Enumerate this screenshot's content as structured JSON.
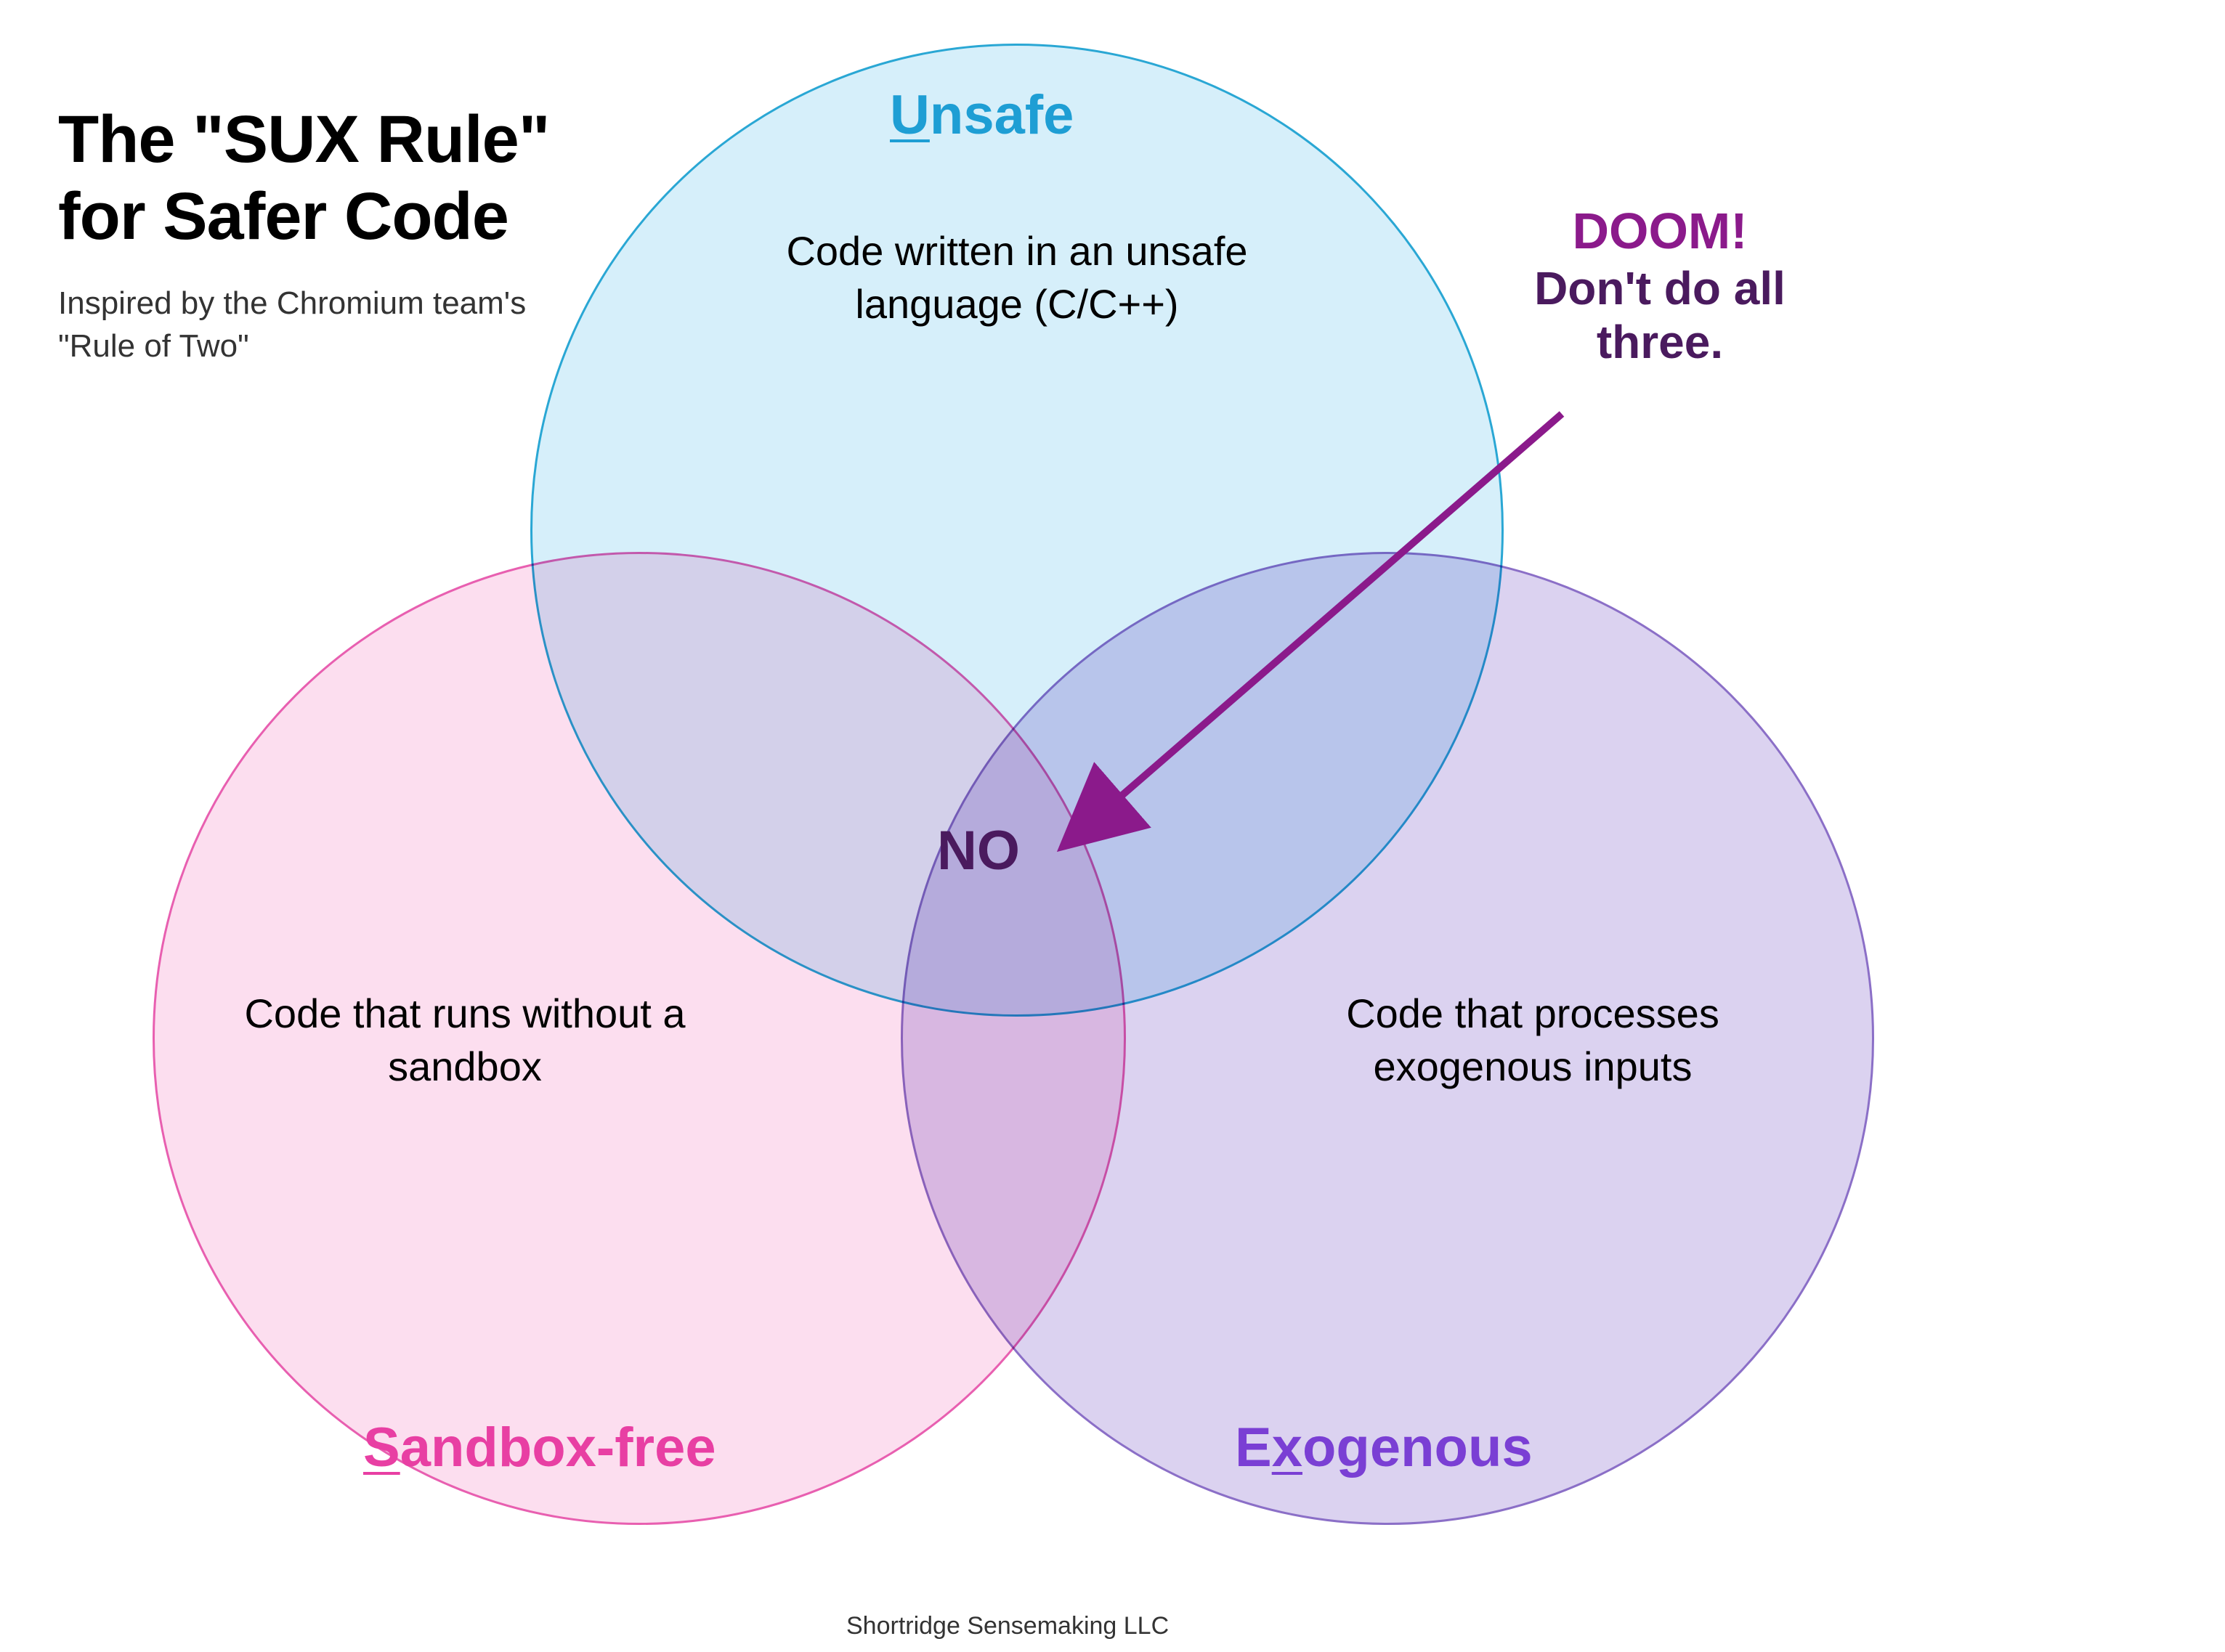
{
  "title": {
    "line1": "The \"SUX Rule\"",
    "line2": "for Safer Code"
  },
  "subtitle": "Inspired by the Chromium team's \"Rule of Two\"",
  "circles": {
    "unsafe": {
      "label_underline": "U",
      "label_rest": "nsafe",
      "description": "Code written in an unsafe language (C/C++)"
    },
    "sandbox": {
      "label_underline": "S",
      "label_rest": "andbox-free",
      "description": "Code that runs without a sandbox"
    },
    "exogenous": {
      "label_prefix": "E",
      "label_underline": "x",
      "label_rest": "ogenous",
      "description": "Code that processes exogenous inputs"
    }
  },
  "center_text": "NO",
  "doom": {
    "title": "DOOM!",
    "subtitle": "Don't do all three."
  },
  "footer": "Shortridge Sensemaking LLC",
  "colors": {
    "unsafe_stroke": "#2aa7d4",
    "unsafe_fill": "rgba(180,225,245,0.55)",
    "sandbox_stroke": "#e85fb0",
    "sandbox_fill": "rgba(250,195,225,0.55)",
    "exogenous_stroke": "#8b6fc7",
    "exogenous_fill": "rgba(195,180,230,0.6)",
    "doom_color": "#8b1a8b",
    "center_color": "#4a1a5e",
    "arrow_color": "#8b1a8b"
  }
}
